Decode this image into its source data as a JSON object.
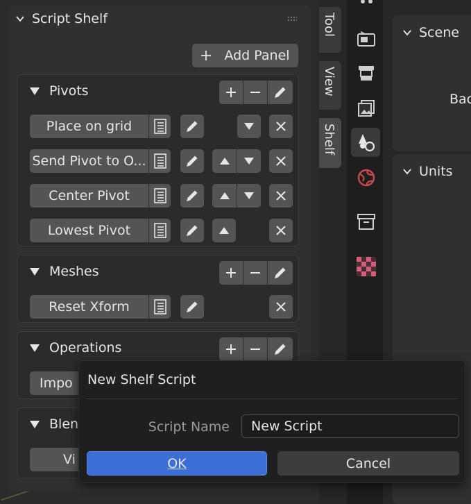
{
  "shelf": {
    "title": "Script Shelf",
    "add_panel_label": "Add Panel"
  },
  "tabs": [
    {
      "label": "Tool"
    },
    {
      "label": "View"
    },
    {
      "label": "Shelf"
    }
  ],
  "panels": {
    "pivots": {
      "title": "Pivots",
      "items": [
        {
          "label": "Place  on grid"
        },
        {
          "label": "Send Pivot to O..."
        },
        {
          "label": "Center Pivot"
        },
        {
          "label": "Lowest Pivot"
        }
      ]
    },
    "meshes": {
      "title": "Meshes",
      "items": [
        {
          "label": "Reset Xform"
        }
      ]
    },
    "operations": {
      "title": "Operations",
      "items": [
        {
          "label": "Impo"
        }
      ]
    },
    "blend": {
      "title": "Blen",
      "items": [
        {
          "label": "Vi"
        }
      ]
    }
  },
  "properties": {
    "scene_label": "Scene",
    "scene_sub": "Bac",
    "units_label": "Units"
  },
  "dialog": {
    "title": "New Shelf Script",
    "script_name_label": "Script Name",
    "script_name_value": "New Script",
    "ok_label": "OK",
    "cancel_label": "Cancel"
  },
  "colors": {
    "accent": "#3b6fd6",
    "panel_bg": "#303030",
    "button_bg": "#545454"
  },
  "icons": [
    "chevron-down-icon",
    "grip-icon",
    "plus-icon",
    "minus-icon",
    "pencil-icon",
    "list-icon",
    "triangle-up-icon",
    "triangle-down-icon",
    "close-icon",
    "render-icon",
    "output-icon",
    "view-layer-icon",
    "scene-icon",
    "world-icon",
    "collection-icon",
    "texture-icon"
  ]
}
